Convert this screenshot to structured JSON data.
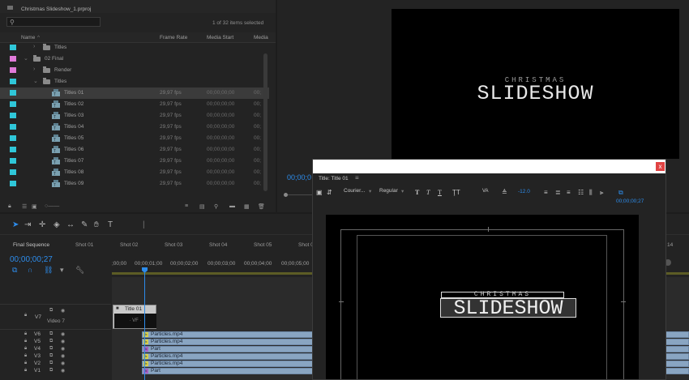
{
  "project": {
    "name": "Christmas Slideshow_1.prproj",
    "search_placeholder": "",
    "selection_count": "1 of 32 items selected",
    "columns": {
      "name": "Name",
      "frame_rate": "Frame Rate",
      "media_start": "Media Start",
      "media_end": "Media"
    },
    "rows": [
      {
        "label": "Titles",
        "swatch": "#2fc7d9",
        "kind": "folder",
        "expanded": false
      },
      {
        "label": "02 Final",
        "swatch": "#e07ad9",
        "kind": "folder",
        "expanded": true
      },
      {
        "label": "Render",
        "swatch": "#e07ad9",
        "kind": "folder",
        "expanded": false
      },
      {
        "label": "Titles",
        "swatch": "#2fc7d9",
        "kind": "folder",
        "expanded": true
      },
      {
        "label": "Titles 01",
        "swatch": "#2fc7d9",
        "kind": "title",
        "fps": "29,97 fps",
        "start": "00;00;00;00",
        "media": "00;",
        "selected": true
      },
      {
        "label": "Titles 02",
        "swatch": "#2fc7d9",
        "kind": "title",
        "fps": "29,97 fps",
        "start": "00;00;00;00",
        "media": "00;"
      },
      {
        "label": "Titles 03",
        "swatch": "#2fc7d9",
        "kind": "title",
        "fps": "29,97 fps",
        "start": "00;00;00;00",
        "media": "00;"
      },
      {
        "label": "Titles 04",
        "swatch": "#2fc7d9",
        "kind": "title",
        "fps": "29,97 fps",
        "start": "00;00;00;00",
        "media": "00;"
      },
      {
        "label": "Titles 05",
        "swatch": "#2fc7d9",
        "kind": "title",
        "fps": "29,97 fps",
        "start": "00;00;00;00",
        "media": "00;"
      },
      {
        "label": "Titles 06",
        "swatch": "#2fc7d9",
        "kind": "title",
        "fps": "29,97 fps",
        "start": "00;00;00;00",
        "media": "00;"
      },
      {
        "label": "Titles 07",
        "swatch": "#2fc7d9",
        "kind": "title",
        "fps": "29,97 fps",
        "start": "00;00;00;00",
        "media": "00;"
      },
      {
        "label": "Titles 08",
        "swatch": "#2fc7d9",
        "kind": "title",
        "fps": "29,97 fps",
        "start": "00;00;00;00",
        "media": "00;"
      },
      {
        "label": "Titles 09",
        "swatch": "#2fc7d9",
        "kind": "title",
        "fps": "29,97 fps",
        "start": "00;00;00;00",
        "media": "00;"
      }
    ]
  },
  "program": {
    "title_small": "CHRISTMAS",
    "title_big": "SLIDESHOW",
    "timecode": "00;00;0"
  },
  "timeline": {
    "sequence_tabs": [
      "Final Sequence",
      "Shot 01",
      "Shot 02",
      "Shot 03",
      "Shot 04",
      "Shot 05",
      "Shot 0",
      "14"
    ],
    "timecode": "00;00;00;27",
    "ruler_labels": [
      ";00;00",
      "00;00;01;00",
      "00;00;02;00",
      "00;00;03;00",
      "00;00;04;00",
      "00;00;05;00"
    ],
    "v7_label": "Video 7",
    "v7_name": "V7",
    "title_clip": {
      "name": "Title 01",
      "thumb_text": "· VF ·"
    },
    "tracks": [
      "V6",
      "V5",
      "V4",
      "V3",
      "V2",
      "V1"
    ],
    "clips": [
      {
        "name": "Particles.mp4",
        "fx": "y"
      },
      {
        "name": "Particles.mp4",
        "fx": "y"
      },
      {
        "name": "Part",
        "fx": "p"
      },
      {
        "name": "Particles.mp4",
        "fx": "y"
      },
      {
        "name": "Particles.mp4",
        "fx": "y"
      },
      {
        "name": "Part",
        "fx": "p"
      }
    ],
    "accent_color": "#2d8ceb"
  },
  "title_window": {
    "tab_label": "Title: Title 01",
    "close_symbol": "x",
    "font_family": "Courier...",
    "font_style": "Regular",
    "kerning_value": "-12.0",
    "timecode": "00;00;00;27",
    "title_small": "CHRISTMAS",
    "title_big": "SLIDESHOW"
  }
}
